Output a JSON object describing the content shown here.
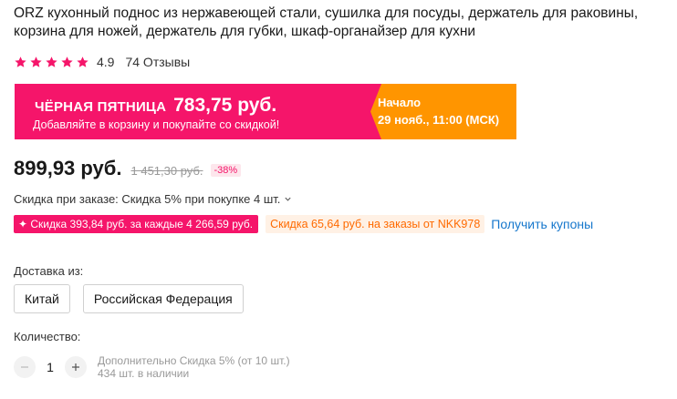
{
  "product": {
    "title": "ORZ кухонный поднос из нержавеющей стали, сушилка для посуды, держатель для раковины, корзина для ножей, держатель для губки, шкаф-органайзер для кухни"
  },
  "rating": {
    "value": "4.9",
    "stars": 5,
    "reviews": "74 Отзывы"
  },
  "promo": {
    "label": "ЧЁРНАЯ ПЯТНИЦА",
    "price": "783,75 руб.",
    "subtitle": "Добавляйте в корзину и покупайте со скидкой!",
    "start_label": "Начало",
    "start_date": "29 нояб., 11:00 (МСК)",
    "colors": {
      "left": "#f5156a",
      "right": "#ff9500"
    }
  },
  "price": {
    "current": "899,93 руб.",
    "old": "1 451,30 руб.",
    "discount": "-38%"
  },
  "order_discount": {
    "text": "Скидка при заказе: Скидка 5% при покупке 4 шт."
  },
  "coupons": {
    "red": "✦ Скидка 393,84 руб. за каждые 4 266,59 руб.",
    "orange": "Скидка 65,64 руб. на заказы от NKK978",
    "link": "Получить купоны"
  },
  "shipping": {
    "label": "Доставка из:",
    "options": [
      "Китай",
      "Российская Федерация"
    ]
  },
  "quantity": {
    "label": "Количество:",
    "value": "1",
    "note": "Дополнительно Скидка 5% (от 10 шт.)",
    "stock": "434 шт. в наличии"
  }
}
